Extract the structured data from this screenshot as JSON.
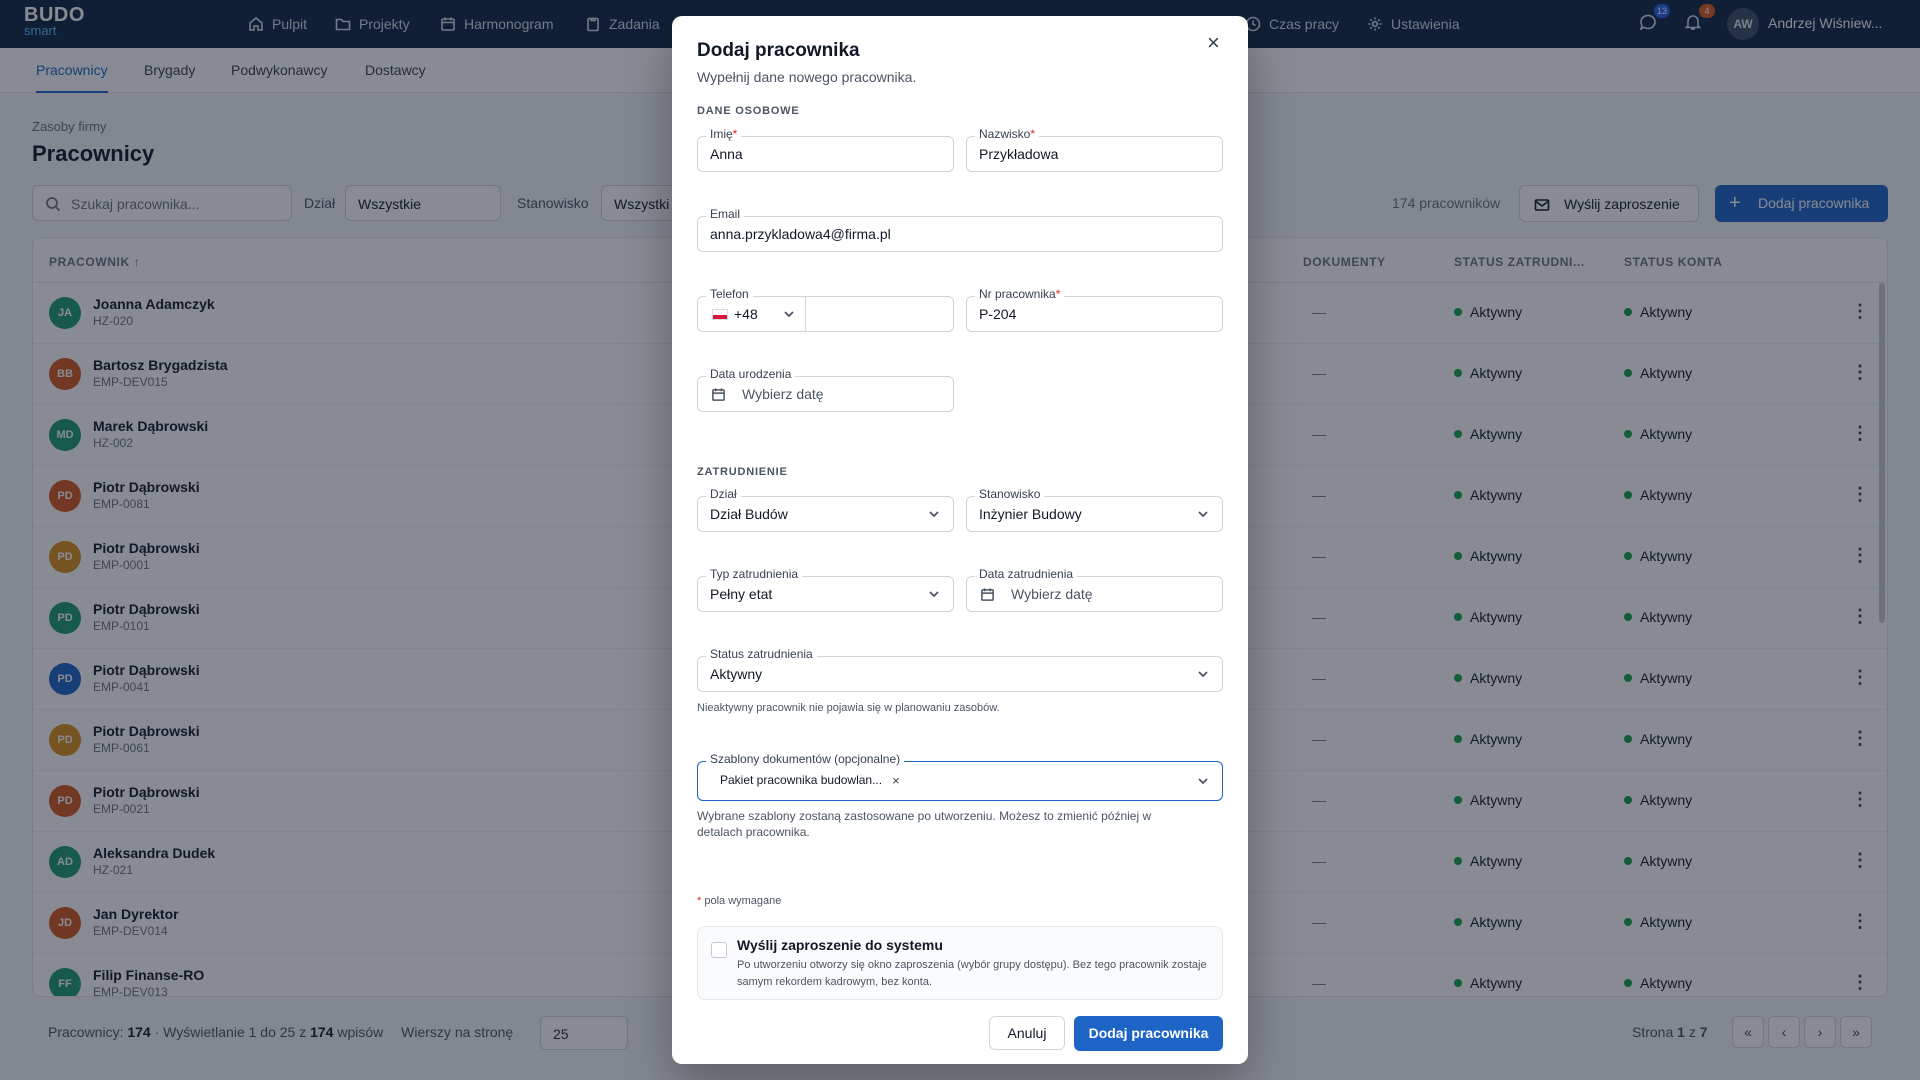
{
  "app": {
    "logo_top": "BUDO",
    "logo_bottom": "smart"
  },
  "nav": [
    {
      "label": "Pulpit",
      "icon": "home-icon"
    },
    {
      "label": "Projekty",
      "icon": "folder-icon"
    },
    {
      "label": "Harmonogram",
      "icon": "calendar-icon"
    },
    {
      "label": "Zadania",
      "icon": "clipboard-icon"
    },
    {
      "label": "Czas pracy",
      "icon": "clock-icon"
    },
    {
      "label": "Ustawienia",
      "icon": "gear-icon"
    }
  ],
  "top_right": {
    "messages_count": "13",
    "notifications_count": "4",
    "avatar_initials": "AW",
    "user_name": "Andrzej Wiśniew..."
  },
  "subnav": {
    "tabs": [
      "Pracownicy",
      "Brygady",
      "Podwykonawcy",
      "Dostawcy"
    ],
    "active": "Pracownicy"
  },
  "page": {
    "breadcrumb": "Zasoby firmy",
    "title": "Pracownicy",
    "search_placeholder": "Szukaj pracownika...",
    "filter_dept_label": "Dział",
    "filter_dept_value": "Wszystkie",
    "filter_pos_label": "Stanowisko",
    "filter_pos_value": "Wszystki",
    "count": "174 pracowników",
    "invite_button": "Wyślij zaproszenie",
    "add_button": "Dodaj pracownika"
  },
  "table": {
    "headers": {
      "employee": "PRACOWNIK ↑",
      "documents": "DOKUMENTY",
      "emp_status": "STATUS ZATRUDNI...",
      "acc_status": "STATUS KONTA"
    },
    "rows": [
      {
        "initials": "JA",
        "name": "Joanna Adamczyk",
        "code": "HZ-020",
        "color": "#1f9d6b",
        "docs": "—",
        "emp": "Aktywny",
        "acc": "Aktywny"
      },
      {
        "initials": "BB",
        "name": "Bartosz Brygadzista",
        "code": "EMP-DEV015",
        "color": "#d4581f",
        "docs": "—",
        "emp": "Aktywny",
        "acc": "Aktywny"
      },
      {
        "initials": "MD",
        "name": "Marek Dąbrowski",
        "code": "HZ-002",
        "color": "#1f9d6b",
        "docs": "—",
        "emp": "Aktywny",
        "acc": "Aktywny"
      },
      {
        "initials": "PD",
        "name": "Piotr Dąbrowski",
        "code": "EMP-0081",
        "color": "#d4581f",
        "docs": "—",
        "emp": "Aktywny",
        "acc": "Aktywny"
      },
      {
        "initials": "PD",
        "name": "Piotr Dąbrowski",
        "code": "EMP-0001",
        "color": "#d9901c",
        "docs": "—",
        "emp": "Aktywny",
        "acc": "Aktywny"
      },
      {
        "initials": "PD",
        "name": "Piotr Dąbrowski",
        "code": "EMP-0101",
        "color": "#1f9d6b",
        "docs": "—",
        "emp": "Aktywny",
        "acc": "Aktywny"
      },
      {
        "initials": "PD",
        "name": "Piotr Dąbrowski",
        "code": "EMP-0041",
        "color": "#1d64c6",
        "docs": "—",
        "emp": "Aktywny",
        "acc": "Aktywny"
      },
      {
        "initials": "PD",
        "name": "Piotr Dąbrowski",
        "code": "EMP-0061",
        "color": "#d9901c",
        "docs": "—",
        "emp": "Aktywny",
        "acc": "Aktywny"
      },
      {
        "initials": "PD",
        "name": "Piotr Dąbrowski",
        "code": "EMP-0021",
        "color": "#d4581f",
        "docs": "—",
        "emp": "Aktywny",
        "acc": "Aktywny"
      },
      {
        "initials": "AD",
        "name": "Aleksandra Dudek",
        "code": "HZ-021",
        "color": "#1f9d6b",
        "docs": "—",
        "emp": "Aktywny",
        "acc": "Aktywny"
      },
      {
        "initials": "JD",
        "name": "Jan Dyrektor",
        "code": "EMP-DEV014",
        "color": "#d4581f",
        "docs": "—",
        "emp": "Aktywny",
        "acc": "Aktywny"
      },
      {
        "initials": "FF",
        "name": "Filip Finanse-RO",
        "code": "EMP-DEV013",
        "color": "#1f9d6b",
        "docs": "—",
        "emp": "Aktywny",
        "acc": "Aktywny"
      }
    ]
  },
  "footer": {
    "label_employees": "Pracownicy:",
    "total": "174",
    "showing_pre": "· Wyświetlanie 1 do 25 z",
    "showing_total": "174",
    "showing_post": "wpisów",
    "rows_label": "Wierszy na stronę",
    "rows_value": "25",
    "page_pre": "Strona",
    "page_current": "1",
    "page_mid": "z",
    "page_total": "7"
  },
  "modal": {
    "title": "Dodaj pracownika",
    "subtitle": "Wypełnij dane nowego pracownika.",
    "section_personal": "DANE OSOBOWE",
    "first_name_label": "Imię",
    "first_name_value": "Anna",
    "last_name_label": "Nazwisko",
    "last_name_value": "Przykładowa",
    "email_label": "Email",
    "email_value": "anna.przykladowa4@firma.pl",
    "phone_label": "Telefon",
    "phone_prefix": "+48",
    "emp_no_label": "Nr pracownika",
    "emp_no_value": "P-204",
    "birth_label": "Data urodzenia",
    "date_placeholder": "Wybierz datę",
    "section_employment": "ZATRUDNIENIE",
    "dept_label": "Dział",
    "dept_value": "Dział Budów",
    "position_label": "Stanowisko",
    "position_value": "Inżynier Budowy",
    "emp_type_label": "Typ zatrudnienia",
    "emp_type_value": "Pełny etat",
    "hire_date_label": "Data zatrudnienia",
    "emp_status_label": "Status zatrudnienia",
    "emp_status_value": "Aktywny",
    "emp_status_hint": "Nieaktywny pracownik nie pojawia się w planowaniu zasobów.",
    "templates_label": "Szablony dokumentów (opcjonalne)",
    "template_chip": "Pakiet pracownika budowlan...",
    "templates_hint": "Wybrane szablony zostaną zastosowane po utworzeniu. Możesz to zmienić później w detalach pracownika.",
    "required_note": "pola wymagane",
    "invite_title": "Wyślij zaproszenie do systemu",
    "invite_desc": "Po utworzeniu otworzy się okno zaproszenia (wybór grupy dostępu). Bez tego pracownik zostaje samym rekordem kadrowym, bez konta.",
    "cancel": "Anuluj",
    "submit": "Dodaj pracownika"
  }
}
